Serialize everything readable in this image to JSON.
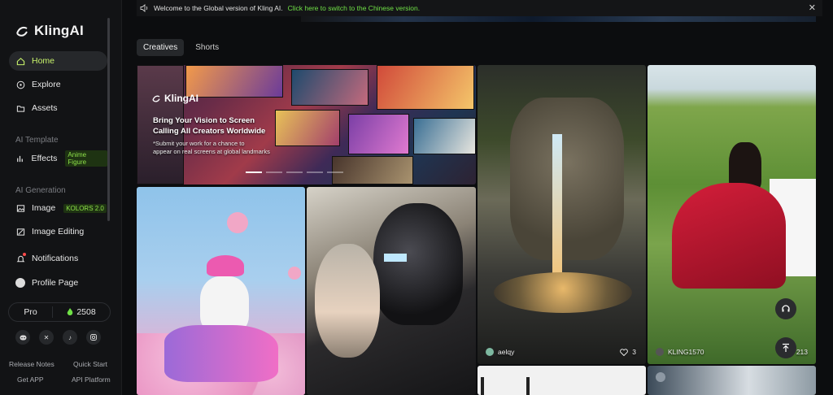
{
  "banner": {
    "text": "Welcome to the Global version of Kling AI.",
    "link": "Click here to switch to the Chinese version."
  },
  "brand": {
    "name": "KlingAI"
  },
  "nav": {
    "home": "Home",
    "explore": "Explore",
    "assets": "Assets",
    "ai_template_label": "AI Template",
    "effects": "Effects",
    "effects_badge": "Anime Figure",
    "ai_generation_label": "AI Generation",
    "image": "Image",
    "image_badge": "KOLORS 2.0",
    "image_editing": "Image Editing",
    "notifications": "Notifications",
    "profile": "Profile Page"
  },
  "plan": {
    "tier": "Pro",
    "credits": "2508"
  },
  "footer": {
    "release_notes": "Release Notes",
    "quick_start": "Quick Start",
    "get_app": "Get APP",
    "api_platform": "API Platform"
  },
  "tabs": [
    "Creatives",
    "Shorts"
  ],
  "hero": {
    "logo": "KlingAI",
    "title_line1": "Bring Your Vision to Screen",
    "title_line2": "Calling All Creators Worldwide",
    "sub_line1": "*Submit your work for a chance to",
    "sub_line2": "appear on real screens at global landmarks"
  },
  "cards": {
    "fountain": {
      "author": "aelqy",
      "likes": "3"
    },
    "piano": {
      "author": "KLING1570",
      "likes": "213"
    }
  },
  "colors": {
    "accent": "#c8f36b",
    "link": "#6fe046",
    "badge_text": "#8fe24a"
  }
}
